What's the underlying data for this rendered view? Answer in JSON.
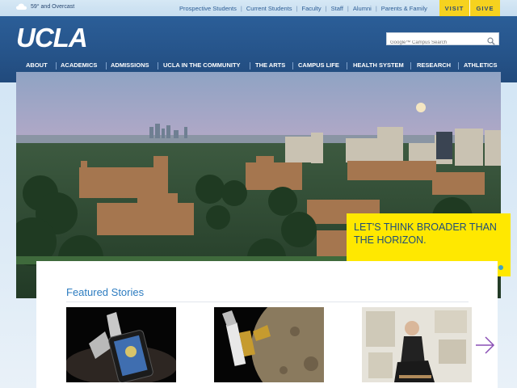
{
  "topbar": {
    "weather": "59° and Overcast",
    "links": [
      "Prospective Students",
      "Current Students",
      "Faculty",
      "Staff",
      "Alumni",
      "Parents & Family"
    ],
    "visit_label": "VISIT",
    "give_label": "GIVE"
  },
  "header": {
    "logo": "UCLA",
    "search_placeholder": "Google™ Campus Search"
  },
  "nav": [
    "ABOUT",
    "ACADEMICS",
    "ADMISSIONS",
    "UCLA IN THE COMMUNITY",
    "THE ARTS",
    "CAMPUS LIFE",
    "HEALTH SYSTEM",
    "RESEARCH",
    "ATHLETICS"
  ],
  "hero": {
    "headline": "LET'S THINK BROADER THAN THE HORIZON.",
    "slides": 3,
    "active_slide": 1
  },
  "featured": {
    "title": "Featured Stories",
    "stories": [
      {
        "image": "smartphone-app-photo"
      },
      {
        "image": "satellite-moon-photo"
      },
      {
        "image": "seated-person-gallery-photo"
      }
    ]
  },
  "colors": {
    "ucla_blue": "#2b5e98",
    "ucla_gold": "#ffe800",
    "link_blue": "#2d7cc0",
    "accent_purple": "#8a4fb5"
  },
  "icons": [
    "cloud-icon",
    "search-icon",
    "next-arrow-icon"
  ]
}
